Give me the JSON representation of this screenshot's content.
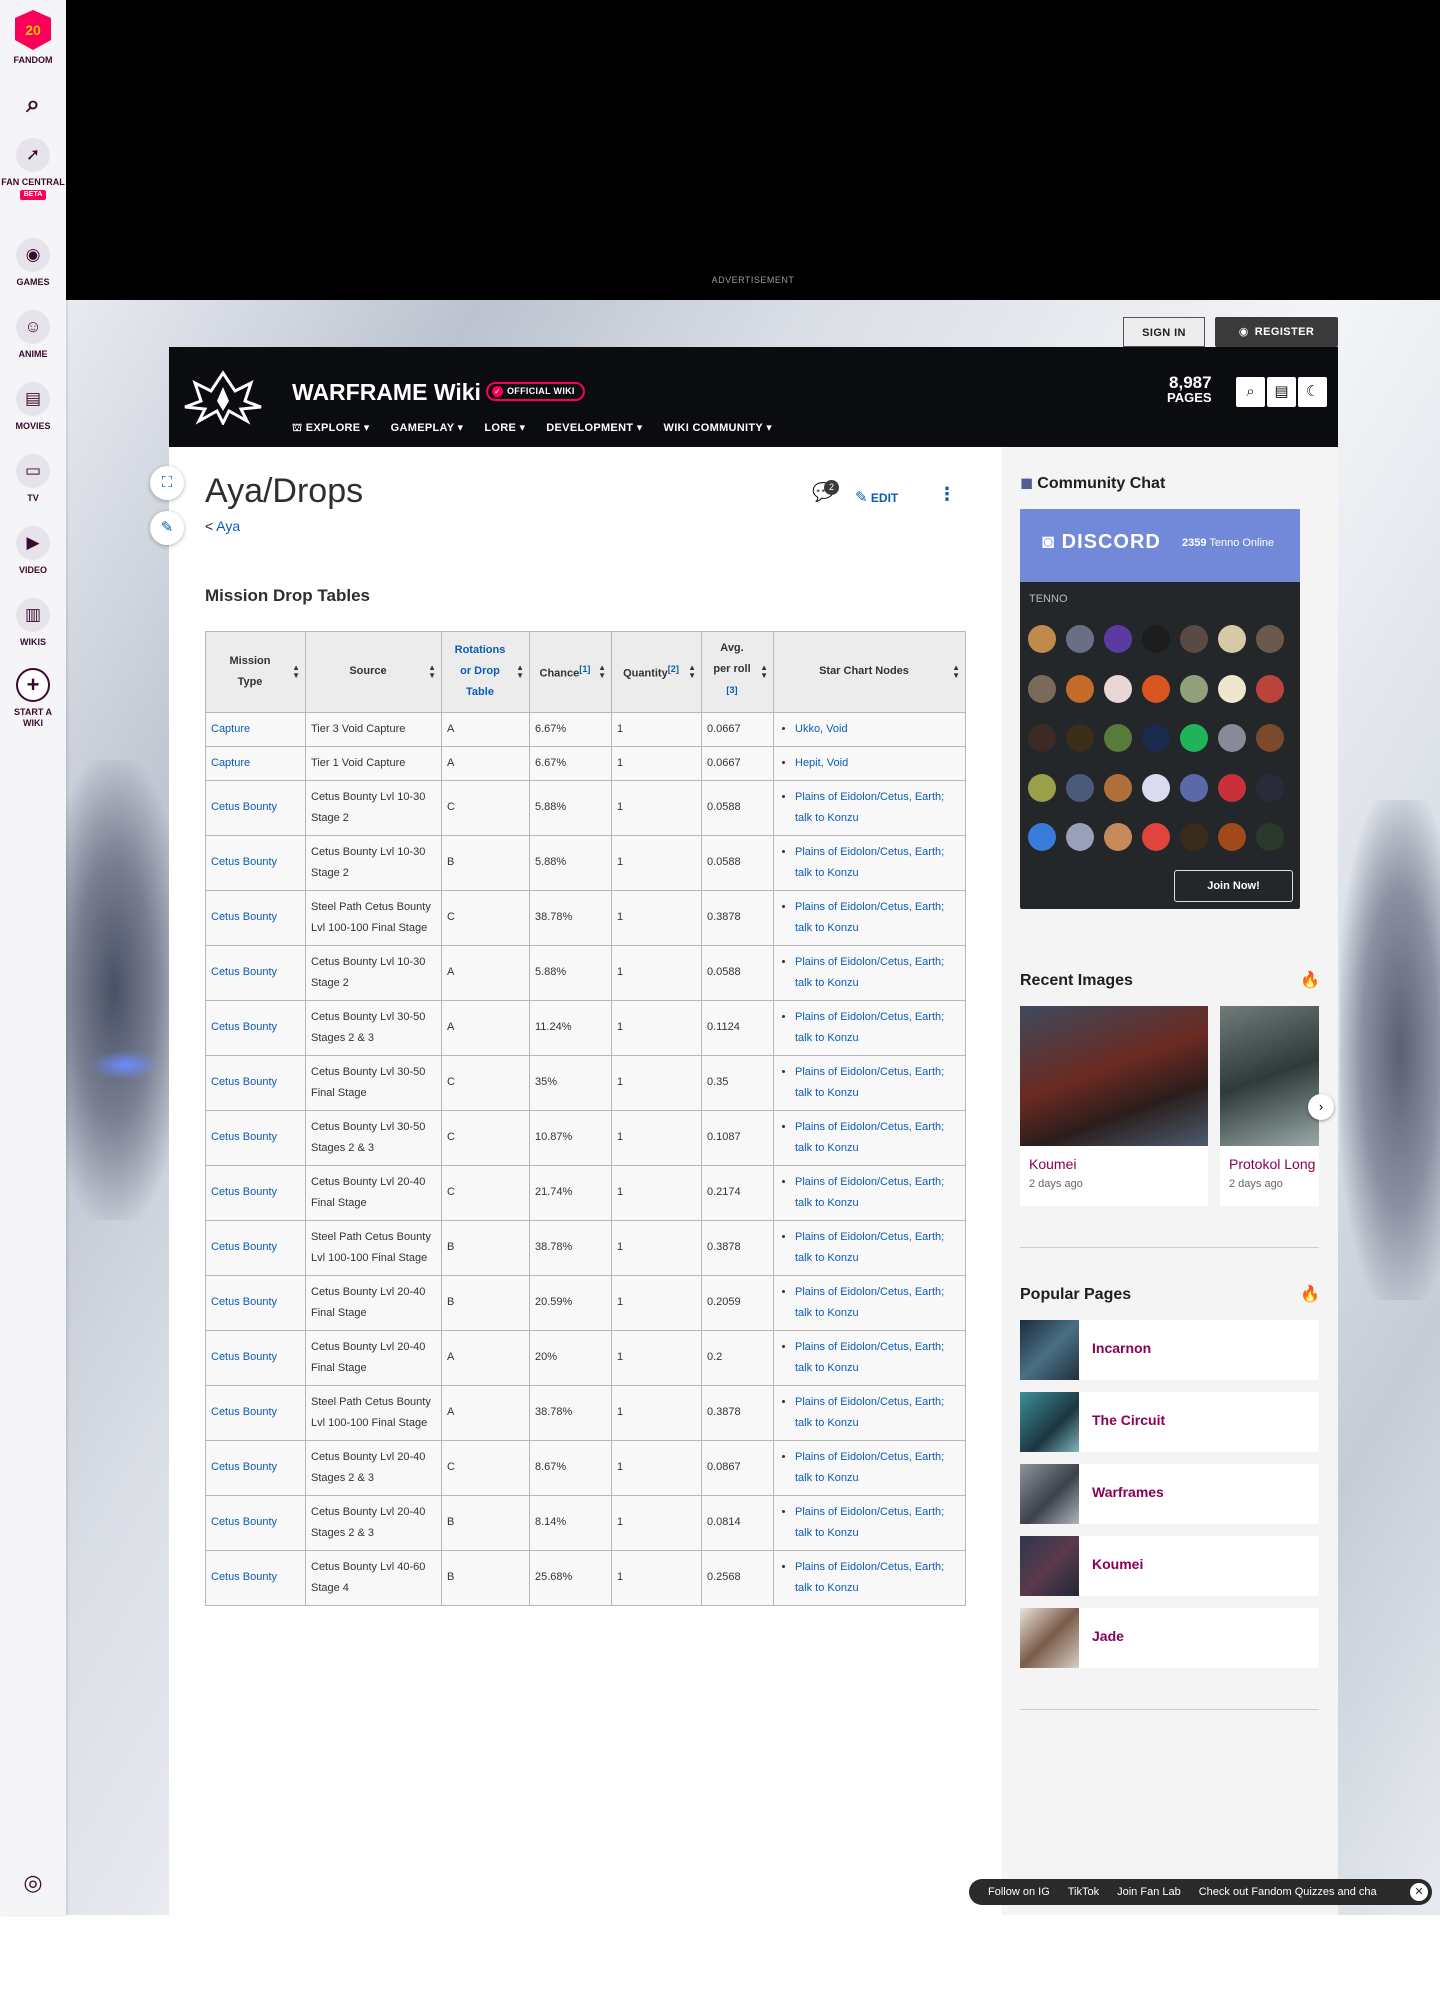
{
  "rail": {
    "logo_number": "20",
    "items": [
      {
        "label": "FANDOM"
      },
      {
        "label": "FAN CENTRAL",
        "badge": "BETA"
      },
      {
        "label": "GAMES"
      },
      {
        "label": "ANIME"
      },
      {
        "label": "MOVIES"
      },
      {
        "label": "TV"
      },
      {
        "label": "VIDEO"
      },
      {
        "label": "WIKIS"
      },
      {
        "label": "START A WIKI"
      }
    ]
  },
  "ad": {
    "label": "ADVERTISEMENT"
  },
  "auth": {
    "sign_in": "SIGN IN",
    "register": "REGISTER"
  },
  "wiki": {
    "title": "WARFRAME Wiki",
    "badge": "OFFICIAL WIKI",
    "nav": [
      "EXPLORE",
      "GAMEPLAY",
      "LORE",
      "DEVELOPMENT",
      "WIKI COMMUNITY"
    ],
    "pages_count": "8,987",
    "pages_label": "PAGES"
  },
  "page": {
    "title": "Aya/Drops",
    "breadcrumb": "Aya",
    "talk_count": "2",
    "edit_label": "EDIT",
    "section_heading": "Mission Drop Tables"
  },
  "table": {
    "headers": [
      "Mission Type",
      "Source",
      "Rotations or Drop Table",
      "Chance",
      "Quantity",
      "Avg. per roll",
      "Star Chart Nodes"
    ],
    "rows": [
      {
        "type": "Capture",
        "source": "Tier 3 Void Capture",
        "rot": "A",
        "chance": "6.67%",
        "qty": "1",
        "avg": "0.0667",
        "node": "Ukko, Void"
      },
      {
        "type": "Capture",
        "source": "Tier 1 Void Capture",
        "rot": "A",
        "chance": "6.67%",
        "qty": "1",
        "avg": "0.0667",
        "node": "Hepit, Void"
      },
      {
        "type": "Cetus Bounty",
        "source": "Cetus Bounty Lvl 10-30 Stage 2",
        "rot": "C",
        "chance": "5.88%",
        "qty": "1",
        "avg": "0.0588",
        "node": "Plains of Eidolon/Cetus, Earth; talk to Konzu"
      },
      {
        "type": "Cetus Bounty",
        "source": "Cetus Bounty Lvl 10-30 Stage 2",
        "rot": "B",
        "chance": "5.88%",
        "qty": "1",
        "avg": "0.0588",
        "node": "Plains of Eidolon/Cetus, Earth; talk to Konzu"
      },
      {
        "type": "Cetus Bounty",
        "source": "Steel Path Cetus Bounty Lvl 100-100 Final Stage",
        "rot": "C",
        "chance": "38.78%",
        "qty": "1",
        "avg": "0.3878",
        "node": "Plains of Eidolon/Cetus, Earth; talk to Konzu"
      },
      {
        "type": "Cetus Bounty",
        "source": "Cetus Bounty Lvl 10-30 Stage 2",
        "rot": "A",
        "chance": "5.88%",
        "qty": "1",
        "avg": "0.0588",
        "node": "Plains of Eidolon/Cetus, Earth; talk to Konzu"
      },
      {
        "type": "Cetus Bounty",
        "source": "Cetus Bounty Lvl 30-50 Stages 2 & 3",
        "rot": "A",
        "chance": "11.24%",
        "qty": "1",
        "avg": "0.1124",
        "node": "Plains of Eidolon/Cetus, Earth; talk to Konzu"
      },
      {
        "type": "Cetus Bounty",
        "source": "Cetus Bounty Lvl 30-50 Final Stage",
        "rot": "C",
        "chance": "35%",
        "qty": "1",
        "avg": "0.35",
        "node": "Plains of Eidolon/Cetus, Earth; talk to Konzu"
      },
      {
        "type": "Cetus Bounty",
        "source": "Cetus Bounty Lvl 30-50 Stages 2 & 3",
        "rot": "C",
        "chance": "10.87%",
        "qty": "1",
        "avg": "0.1087",
        "node": "Plains of Eidolon/Cetus, Earth; talk to Konzu"
      },
      {
        "type": "Cetus Bounty",
        "source": "Cetus Bounty Lvl 20-40 Final Stage",
        "rot": "C",
        "chance": "21.74%",
        "qty": "1",
        "avg": "0.2174",
        "node": "Plains of Eidolon/Cetus, Earth; talk to Konzu"
      },
      {
        "type": "Cetus Bounty",
        "source": "Steel Path Cetus Bounty Lvl 100-100 Final Stage",
        "rot": "B",
        "chance": "38.78%",
        "qty": "1",
        "avg": "0.3878",
        "node": "Plains of Eidolon/Cetus, Earth; talk to Konzu"
      },
      {
        "type": "Cetus Bounty",
        "source": "Cetus Bounty Lvl 20-40 Final Stage",
        "rot": "B",
        "chance": "20.59%",
        "qty": "1",
        "avg": "0.2059",
        "node": "Plains of Eidolon/Cetus, Earth; talk to Konzu"
      },
      {
        "type": "Cetus Bounty",
        "source": "Cetus Bounty Lvl 20-40 Final Stage",
        "rot": "A",
        "chance": "20%",
        "qty": "1",
        "avg": "0.2",
        "node": "Plains of Eidolon/Cetus, Earth; talk to Konzu"
      },
      {
        "type": "Cetus Bounty",
        "source": "Steel Path Cetus Bounty Lvl 100-100 Final Stage",
        "rot": "A",
        "chance": "38.78%",
        "qty": "1",
        "avg": "0.3878",
        "node": "Plains of Eidolon/Cetus, Earth; talk to Konzu"
      },
      {
        "type": "Cetus Bounty",
        "source": "Cetus Bounty Lvl 20-40 Stages 2 & 3",
        "rot": "C",
        "chance": "8.67%",
        "qty": "1",
        "avg": "0.0867",
        "node": "Plains of Eidolon/Cetus, Earth; talk to Konzu"
      },
      {
        "type": "Cetus Bounty",
        "source": "Cetus Bounty Lvl 20-40 Stages 2 & 3",
        "rot": "B",
        "chance": "8.14%",
        "qty": "1",
        "avg": "0.0814",
        "node": "Plains of Eidolon/Cetus, Earth; talk to Konzu"
      },
      {
        "type": "Cetus Bounty",
        "source": "Cetus Bounty Lvl 40-60 Stage 4",
        "rot": "B",
        "chance": "25.68%",
        "qty": "1",
        "avg": "0.2568",
        "node": "Plains of Eidolon/Cetus, Earth; talk to Konzu"
      }
    ]
  },
  "sidebar": {
    "community_chat": "Community Chat",
    "discord": {
      "brand": "DISCORD",
      "online_count": "2359",
      "online_label": "Tenno Online",
      "channel": "TENNO",
      "join": "Join Now!"
    },
    "recent_images": {
      "heading": "Recent Images",
      "items": [
        {
          "name": "Koumei",
          "time": "2 days ago"
        },
        {
          "name": "Protokol Long",
          "time": "2 days ago"
        }
      ]
    },
    "popular_pages": {
      "heading": "Popular Pages",
      "items": [
        "Incarnon",
        "The Circuit",
        "Warframes",
        "Koumei",
        "Jade"
      ]
    }
  },
  "footer_bar": [
    "Follow on IG",
    "TikTok",
    "Join Fan Lab",
    "Check out Fandom Quizzes and cha"
  ]
}
